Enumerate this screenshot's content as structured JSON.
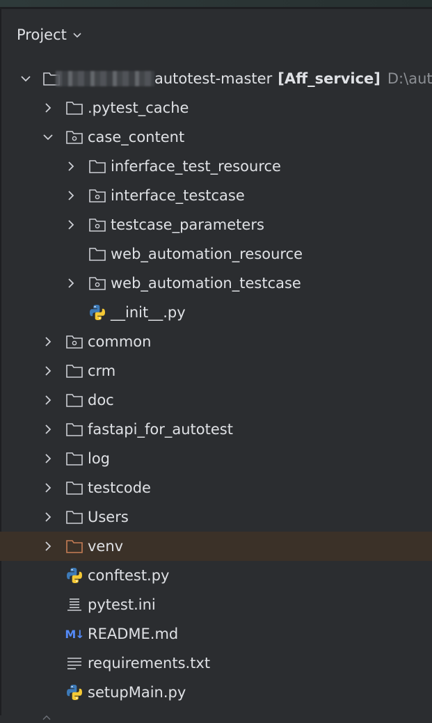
{
  "panel": {
    "title": "Project"
  },
  "tree": {
    "root": {
      "name": "autotest-master",
      "module": "[Aff_service]",
      "path": "D:\\auto"
    },
    "items": [
      {
        "label": ".pytest_cache",
        "icon": "folder-icon",
        "expanded": false
      },
      {
        "label": "case_content",
        "icon": "package-folder-icon",
        "expanded": true
      },
      {
        "label": "inferface_test_resource",
        "icon": "folder-icon",
        "expanded": false
      },
      {
        "label": "interface_testcase",
        "icon": "package-folder-icon",
        "expanded": false
      },
      {
        "label": "testcase_parameters",
        "icon": "package-folder-icon",
        "expanded": false
      },
      {
        "label": "web_automation_resource",
        "icon": "folder-icon"
      },
      {
        "label": "web_automation_testcase",
        "icon": "package-folder-icon",
        "expanded": false
      },
      {
        "label": "__init__.py",
        "icon": "python-file-icon"
      },
      {
        "label": "common",
        "icon": "package-folder-icon",
        "expanded": false
      },
      {
        "label": "crm",
        "icon": "folder-icon",
        "expanded": false
      },
      {
        "label": "doc",
        "icon": "folder-icon",
        "expanded": false
      },
      {
        "label": "fastapi_for_autotest",
        "icon": "folder-icon",
        "expanded": false
      },
      {
        "label": "log",
        "icon": "folder-icon",
        "expanded": false
      },
      {
        "label": "testcode",
        "icon": "folder-icon",
        "expanded": false
      },
      {
        "label": "Users",
        "icon": "folder-icon",
        "expanded": false
      },
      {
        "label": "venv",
        "icon": "excluded-folder-icon",
        "expanded": false,
        "selected": true
      },
      {
        "label": "conftest.py",
        "icon": "python-file-icon"
      },
      {
        "label": "pytest.ini",
        "icon": "ini-file-icon"
      },
      {
        "label": "README.md",
        "icon": "markdown-file-icon",
        "icon_text": "M↓"
      },
      {
        "label": "requirements.txt",
        "icon": "text-file-icon"
      },
      {
        "label": "setupMain.py",
        "icon": "python-file-icon"
      }
    ]
  },
  "colors": {
    "background": "#2b2d30",
    "text": "#dfe1e5",
    "muted": "#8c8f94",
    "selection": "#3b3128",
    "excluded_folder": "#c77d55",
    "markdown": "#548af7"
  }
}
